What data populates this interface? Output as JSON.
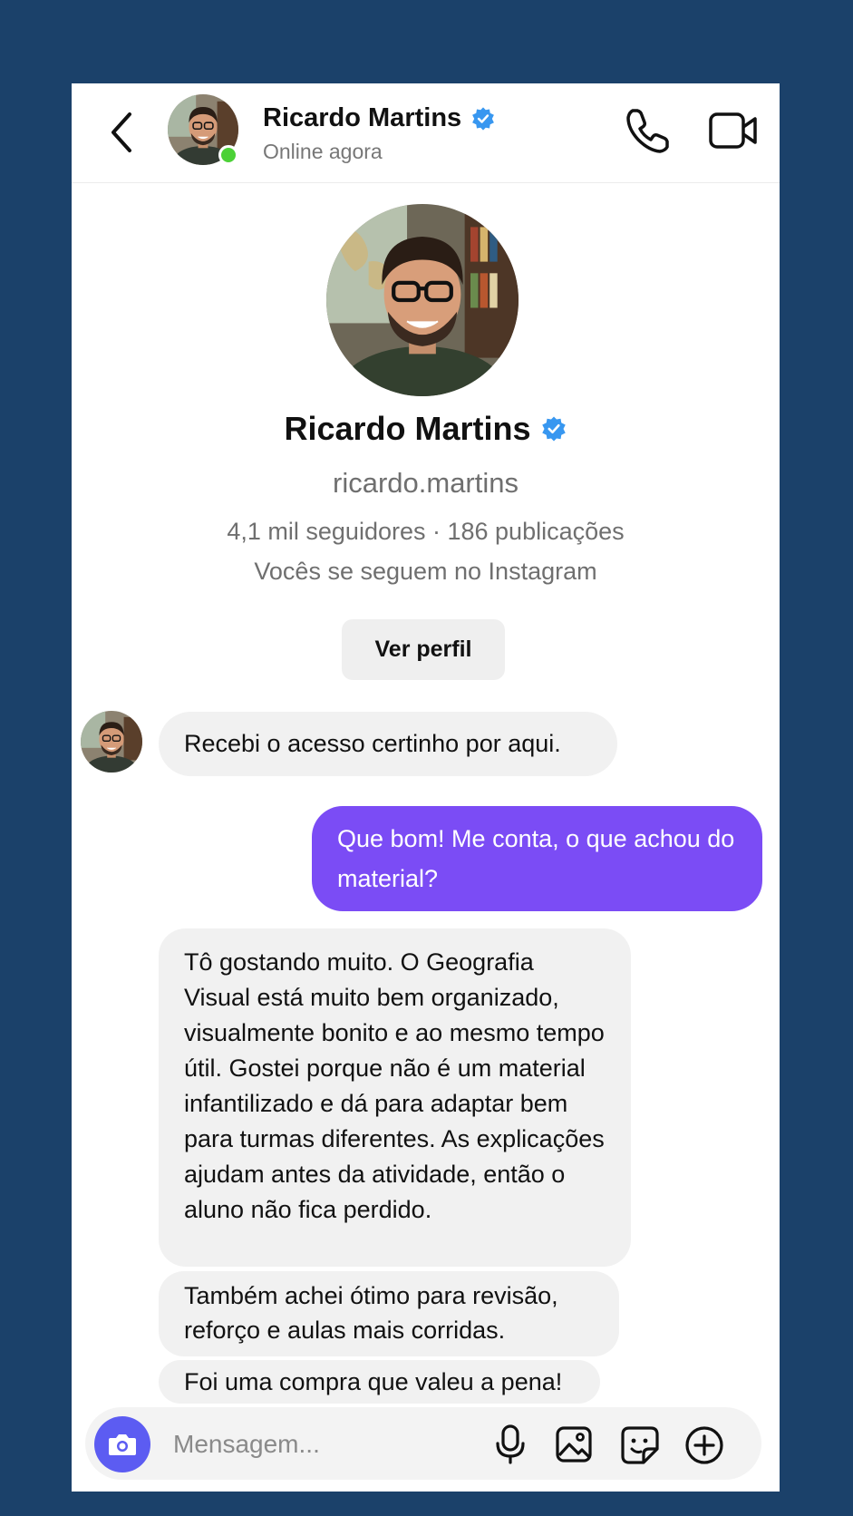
{
  "header": {
    "name": "Ricardo Martins",
    "status": "Online agora",
    "verified": true
  },
  "profile": {
    "name": "Ricardo Martins",
    "handle": "ricardo.martins",
    "stats": "4,1 mil seguidores · 186 publicações",
    "mutual": "Vocês se seguem no Instagram",
    "view_profile_label": "Ver perfil"
  },
  "messages": [
    {
      "from": "them",
      "text": "Recebi o acesso certinho por aqui."
    },
    {
      "from": "me",
      "text": "Que bom! Me conta, o que achou do material?"
    },
    {
      "from": "them",
      "text": "Tô gostando muito. O Geografia Visual está muito bem organizado, visualmente bonito e ao mesmo tempo útil. Gostei porque não é um material infantilizado e dá para adaptar bem para turmas diferentes. As explicações ajudam antes da atividade, então o aluno não fica perdido."
    },
    {
      "from": "them",
      "text": "Também achei ótimo para revisão, reforço e aulas mais corridas."
    },
    {
      "from": "them",
      "text": "Foi uma compra que valeu a pena!"
    }
  ],
  "composer": {
    "placeholder": "Mensagem..."
  },
  "colors": {
    "background": "#1b416a",
    "outgoing_bubble": "#7b4cf5",
    "incoming_bubble": "#f1f1f1",
    "camera_button": "#5c5cf2",
    "verified_badge": "#3897f0",
    "online_dot": "#4cd137"
  },
  "icons": [
    "back-arrow-icon",
    "verified-badge-icon",
    "phone-icon",
    "video-camera-icon",
    "camera-icon",
    "microphone-icon",
    "image-icon",
    "sticker-icon",
    "plus-circle-icon"
  ]
}
